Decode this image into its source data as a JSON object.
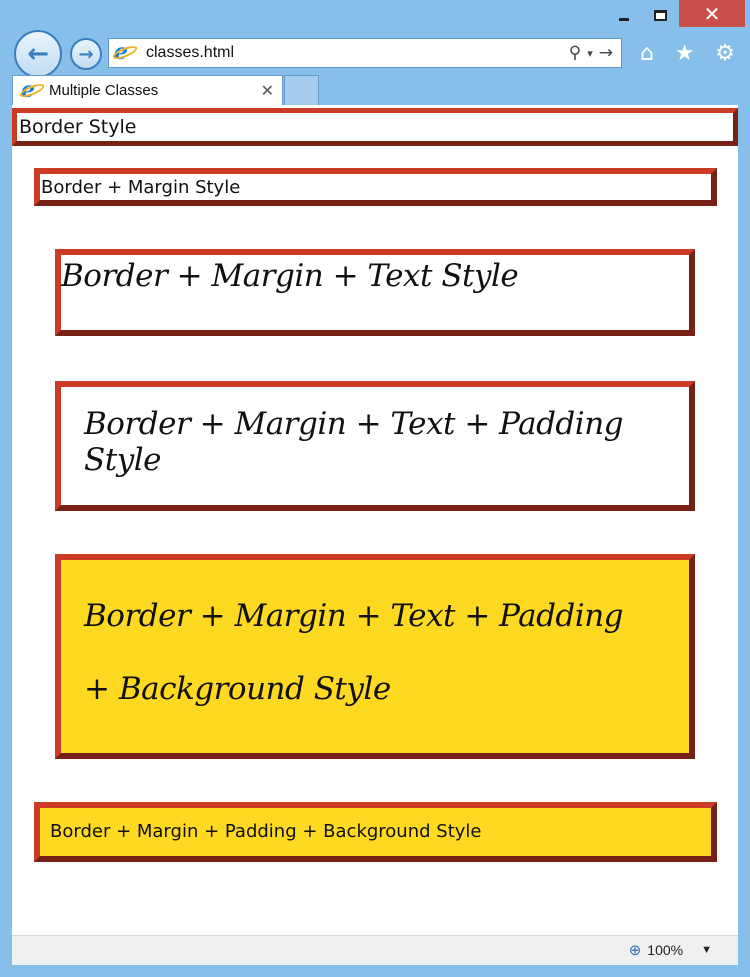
{
  "window": {
    "minimize_icon": "minimize-icon",
    "maximize_icon": "maximize-icon",
    "close_glyph": "✕"
  },
  "nav": {
    "back_glyph": "←",
    "forward_glyph": "→",
    "address": "classes.html",
    "search_glyph": "⚲",
    "dropdown_glyph": "▾",
    "go_glyph": "→",
    "home_glyph": "⌂",
    "favorites_glyph": "★",
    "tools_glyph": "⚙"
  },
  "tabs": [
    {
      "label": "Multiple Classes",
      "close_glyph": "✕"
    }
  ],
  "boxes": [
    "Border Style",
    "Border + Margin Style",
    "Border + Margin + Text Style",
    "Border + Margin + Text + Padding Style",
    "Border + Margin + Text + Padding + Background Style",
    "Border + Margin + Padding + Background Style"
  ],
  "status": {
    "zoom": "100%",
    "zoom_caret": "▼"
  },
  "colors": {
    "border": "#cc3b26",
    "background_yellow": "#fdd922",
    "chrome": "#86c0ea",
    "close_button": "#c9504a"
  }
}
